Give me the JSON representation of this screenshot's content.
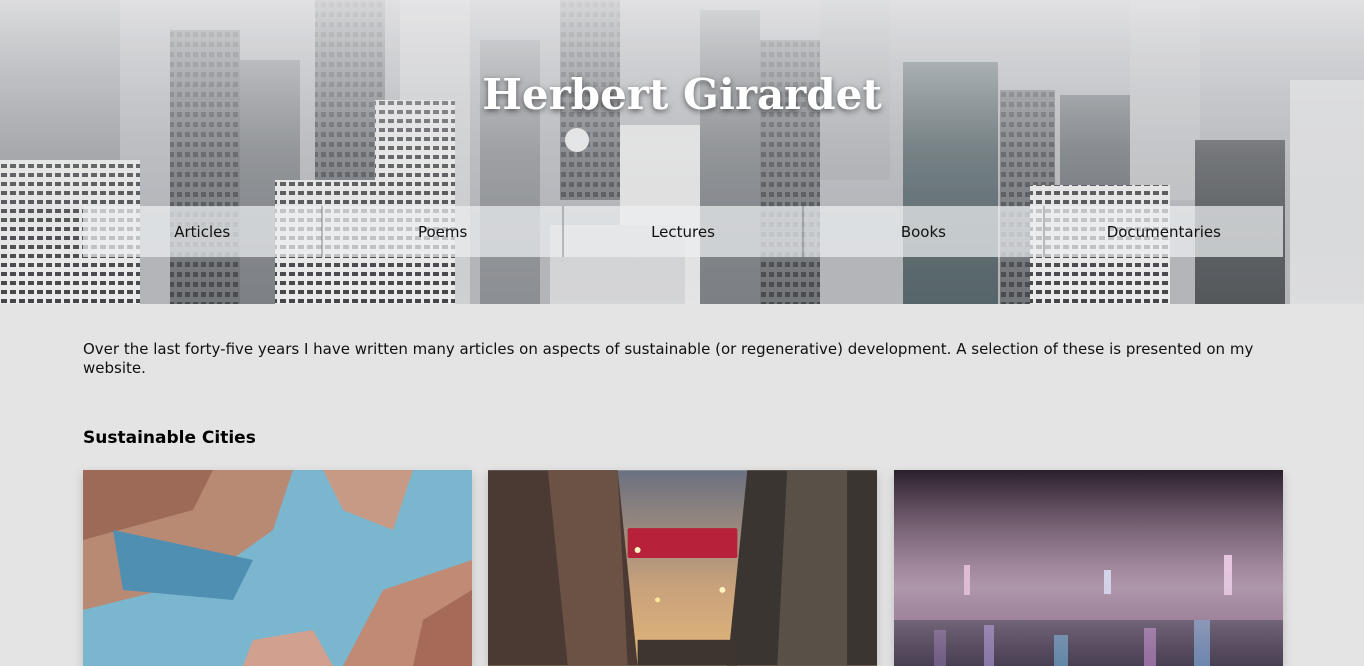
{
  "site": {
    "title": "Herbert Girardet"
  },
  "nav": {
    "items": [
      {
        "label": "Articles"
      },
      {
        "label": "Poems"
      },
      {
        "label": "Lectures"
      },
      {
        "label": "Books"
      },
      {
        "label": "Documentaries"
      }
    ]
  },
  "main": {
    "intro": "Over the last forty-five years I have written many articles on aspects of sustainable (or regenerative) development. A selection of these is presented on my website.",
    "section_title": "Sustainable Cities"
  },
  "cards": [
    {
      "image": "skyscrapers-looking-up"
    },
    {
      "image": "city-street-christmas-banner"
    },
    {
      "image": "foggy-city-night"
    }
  ],
  "colors": {
    "page_background": "#e4e4e4",
    "nav_background": "#eceef0",
    "title_text": "#ffffff"
  }
}
